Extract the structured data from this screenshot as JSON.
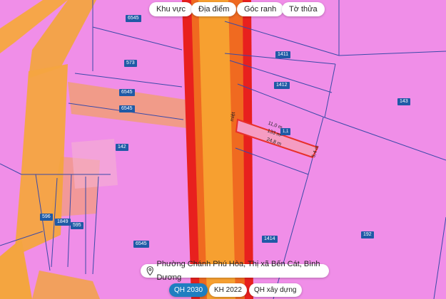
{
  "filters": [
    "Khu vực",
    "Địa điểm",
    "Góc ranh",
    "Tờ thửa"
  ],
  "parcels": [
    "6545",
    "573",
    "6545",
    "6545",
    "142",
    "1411",
    "1412",
    "143",
    "596",
    "1849",
    "595",
    "6545",
    "1414",
    "192"
  ],
  "road_label": "miệt",
  "selected_parcel": {
    "area": "133 m²",
    "dims": [
      "11,0 m",
      "24,8 m",
      "5,4 m"
    ],
    "extra": "1,1"
  },
  "address": "Phường Chánh Phú Hòa, Thị xã Bến Cát, Bình Dương",
  "tabs": [
    {
      "label": "QH 2030",
      "active": true
    },
    {
      "label": "KH 2022",
      "active": false
    },
    {
      "label": "QH xây dựng",
      "active": false
    }
  ],
  "colors": {
    "residential": "#f08ee8",
    "road_core": "#f7a030",
    "road_edge": "#e8201e",
    "label_bg": "#1f5aa6",
    "active_tab": "#1f7ec0"
  }
}
